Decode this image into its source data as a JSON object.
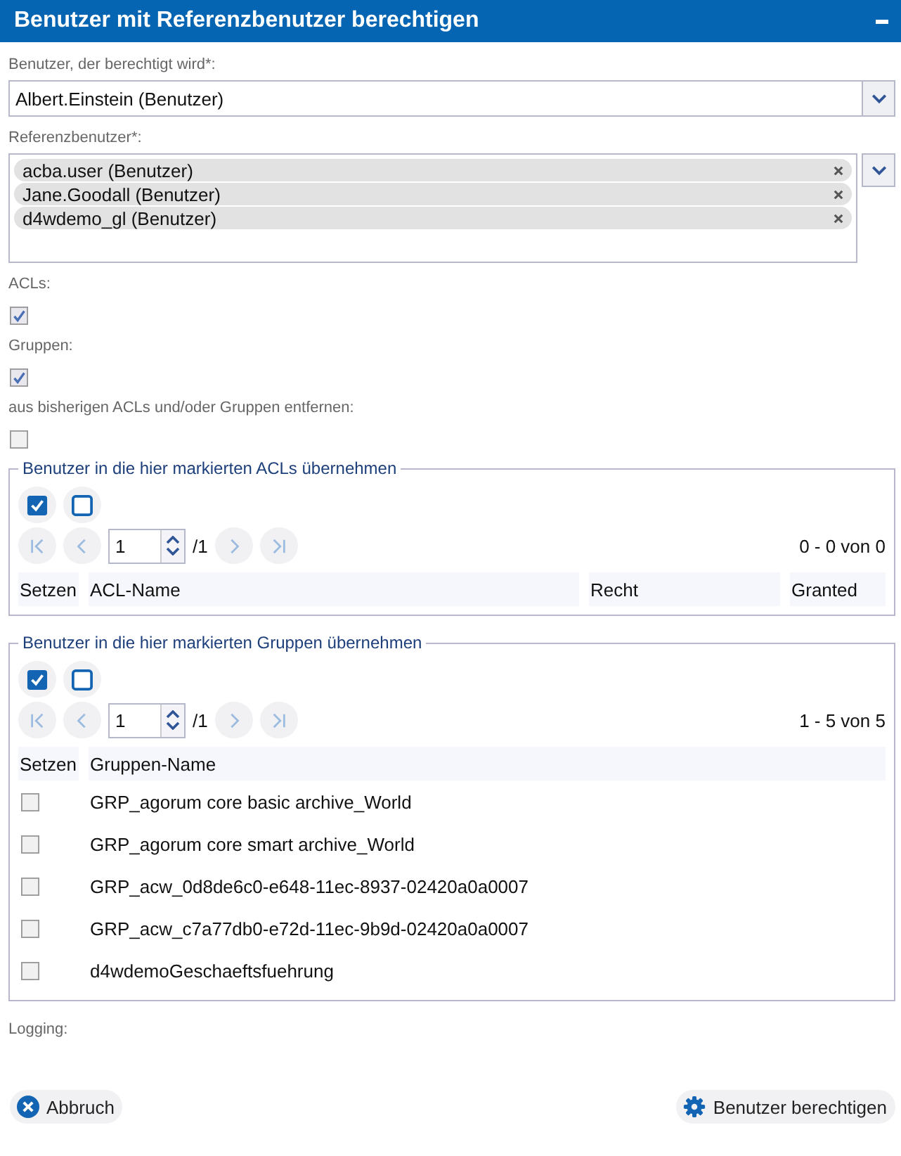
{
  "window": {
    "title": "Benutzer mit Referenzbenutzer berechtigen"
  },
  "user_field": {
    "label": "Benutzer, der berechtigt wird*:",
    "value": "Albert.Einstein (Benutzer)"
  },
  "reference_users": {
    "label": "Referenzbenutzer*:",
    "tokens": [
      {
        "text": "acba.user (Benutzer)"
      },
      {
        "text": "Jane.Goodall (Benutzer)"
      },
      {
        "text": "d4wdemo_gl (Benutzer)"
      }
    ]
  },
  "options": [
    {
      "label": "ACLs:",
      "checked": true
    },
    {
      "label": "Gruppen:",
      "checked": true
    },
    {
      "label": "aus bisherigen ACLs und/oder Gruppen entfernen:",
      "checked": false
    }
  ],
  "panels": [
    {
      "legend": "Benutzer in die hier markierten ACLs übernehmen",
      "pager": {
        "page": "1",
        "total": "/1",
        "range": "0 - 0 von 0"
      },
      "columns": [
        "Setzen",
        "ACL-Name",
        "Recht",
        "Granted"
      ]
    },
    {
      "legend": "Benutzer in die hier markierten Gruppen übernehmen",
      "pager": {
        "page": "1",
        "total": "/1",
        "range": "1 - 5 von 5"
      },
      "columns": [
        "Setzen",
        "Gruppen-Name"
      ],
      "rows": [
        {
          "name": "GRP_agorum core basic archive_World",
          "checked": false
        },
        {
          "name": "GRP_agorum core smart archive_World",
          "checked": false
        },
        {
          "name": "GRP_acw_0d8de6c0-e648-11ec-8937-02420a0a0007",
          "checked": false
        },
        {
          "name": "GRP_acw_c7a77db0-e72d-11ec-9b9d-02420a0a0007",
          "checked": false
        },
        {
          "name": "d4wdemoGeschaeftsfuehrung",
          "checked": false
        }
      ]
    }
  ],
  "logging": {
    "label": "Logging:"
  },
  "buttons": [
    {
      "kind": "cancel",
      "label": "Abbruch"
    },
    {
      "kind": "confirm",
      "label": "Benutzer berechtigen"
    }
  ]
}
